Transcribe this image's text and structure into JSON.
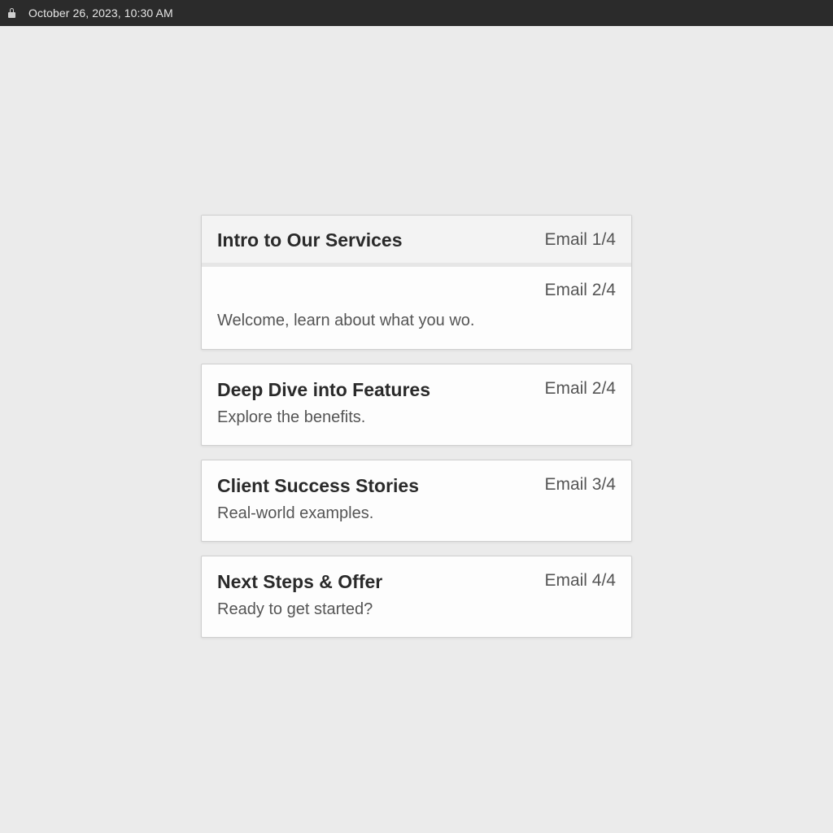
{
  "status_bar": {
    "lock_icon": "lock-icon",
    "datetime": "October 26, 2023, 10:30 AM"
  },
  "emails": [
    {
      "title": "Intro to Our Services",
      "tag": "Email 1/4",
      "tag_secondary": "Email 2/4",
      "subtitle": "Welcome, learn about what you wo."
    },
    {
      "title": "Deep Dive into Features",
      "tag": "Email 2/4",
      "subtitle": "Explore the benefits."
    },
    {
      "title": "Client Success Stories",
      "tag": "Email 3/4",
      "subtitle": "Real-world examples."
    },
    {
      "title": "Next Steps & Offer",
      "tag": "Email 4/4",
      "subtitle": "Ready to get started?"
    }
  ],
  "colors": {
    "background": "#ebebeb",
    "status_bar": "#2b2b2b",
    "card": "#fdfdfd",
    "card_header": "#f3f3f3",
    "title_text": "#2a2a2a",
    "secondary_text": "#555555"
  }
}
